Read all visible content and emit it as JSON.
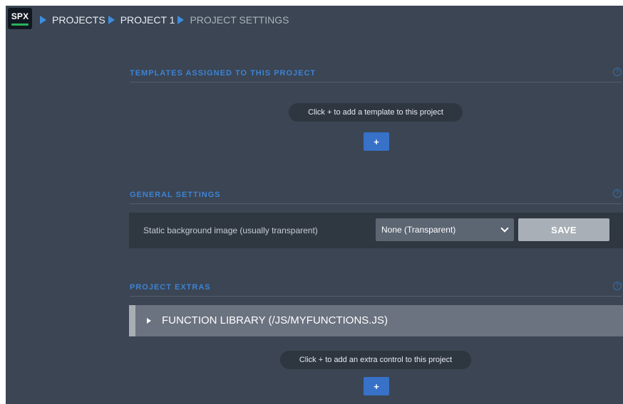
{
  "app": {
    "logo_text": "SPX"
  },
  "breadcrumb": {
    "items": [
      "PROJECTS",
      "PROJECT 1",
      "PROJECT SETTINGS"
    ]
  },
  "sections": {
    "templates": {
      "title": "TEMPLATES ASSIGNED TO THIS PROJECT",
      "hint": "Click + to add a template to this project",
      "add_label": "+"
    },
    "general": {
      "title": "GENERAL SETTINGS",
      "setting_label": "Static background image (usually transparent)",
      "select_value": "None (Transparent)",
      "save_label": "SAVE"
    },
    "extras": {
      "title": "PROJECT EXTRAS",
      "accordion_label": "FUNCTION LIBRARY (/JS/MYFUNCTIONS.JS)",
      "hint": "Click + to add an extra control to this project",
      "add_label": "+"
    }
  },
  "help_glyph": "?",
  "colors": {
    "background": "#3b4553",
    "accent": "#3d83d6",
    "button_blue": "#3771c8",
    "save_gray": "#a9afb6"
  }
}
